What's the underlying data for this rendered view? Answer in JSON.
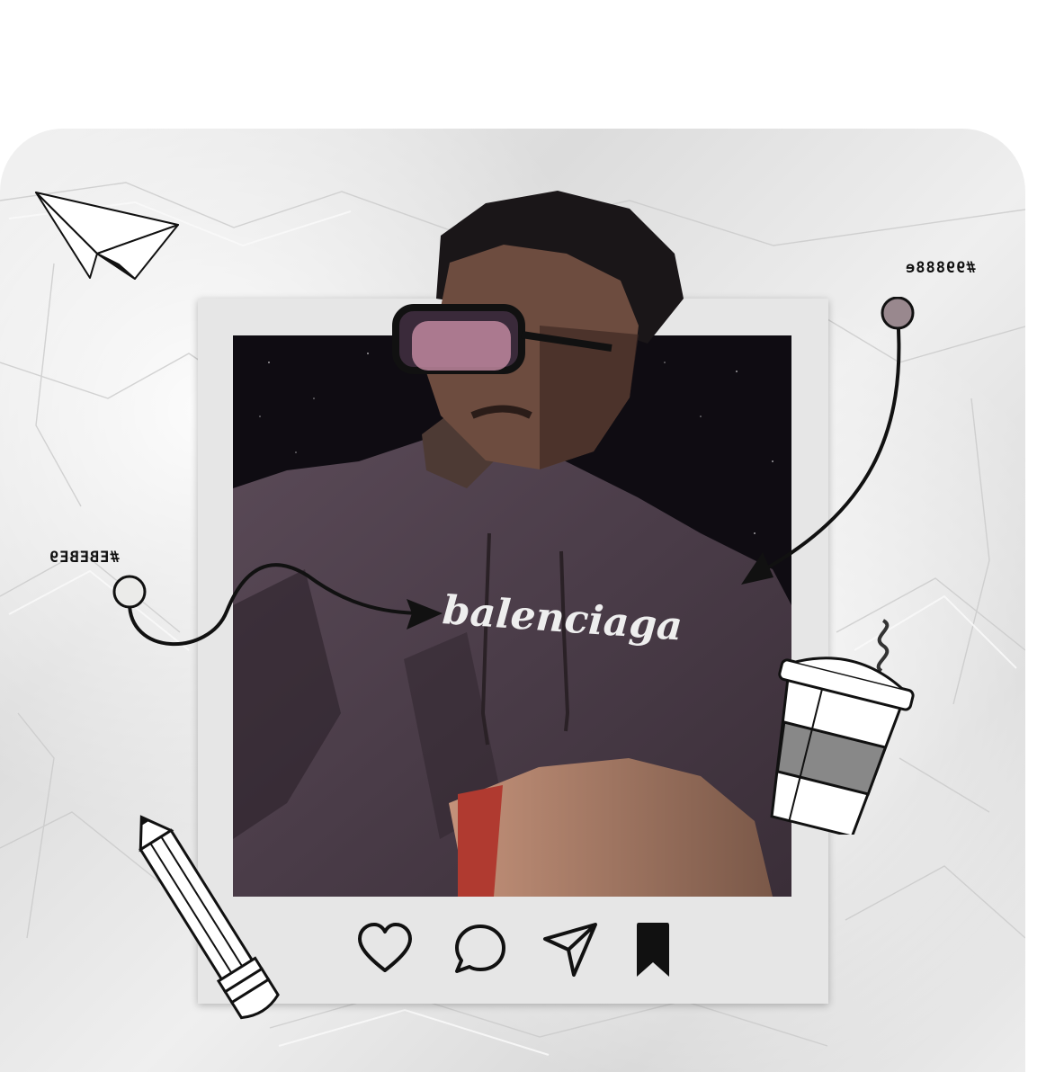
{
  "annotations": {
    "left_label": "#EBEBE9",
    "right_label": "#99888e"
  },
  "colors": {
    "left_swatch": "#EBEBE9",
    "right_swatch": "#99888e",
    "polaroid_frame": "#e6e6e6",
    "background": "#ffffff"
  },
  "icons": [
    "heart-icon",
    "comment-icon",
    "send-icon",
    "bookmark-icon"
  ],
  "photo": {
    "shirt_text": "balenciaga"
  }
}
